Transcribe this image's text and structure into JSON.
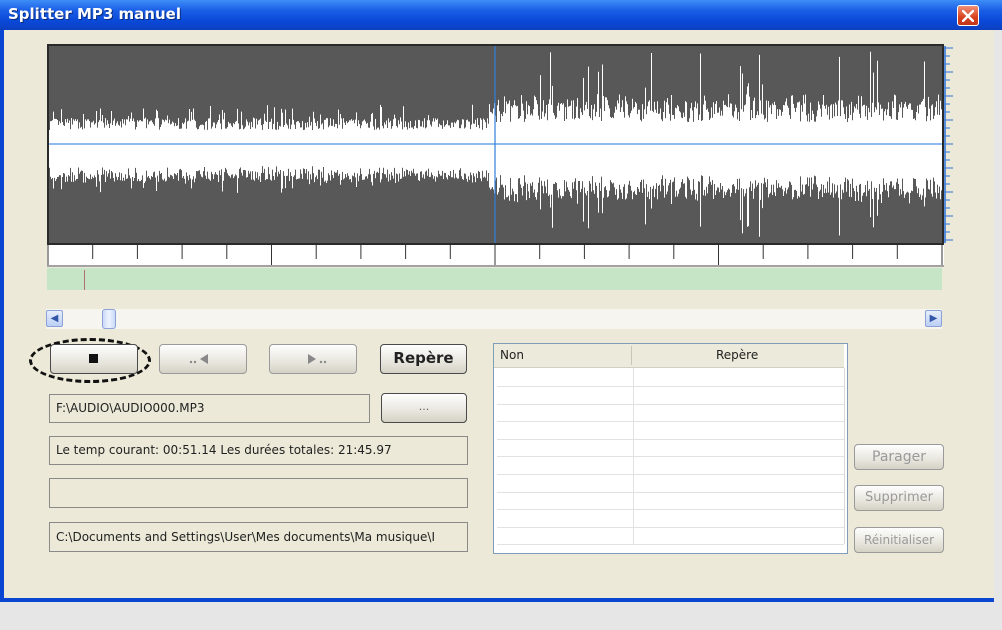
{
  "window": {
    "title": "Splitter MP3 manuel"
  },
  "controls": {
    "repere_label": "Repère",
    "browse_label": "...",
    "prev_label": "..◄",
    "next_label": "►.."
  },
  "fields": {
    "source_path": "F:\\AUDIO\\AUDIO000.MP3",
    "time_info": "Le temp courant: 00:51.14  Les durées totales: 21:45.97",
    "empty": "",
    "output_path": "C:\\Documents and Settings\\User\\Mes documents\\Ma musique\\I"
  },
  "list": {
    "columns": [
      "Non",
      "Repère"
    ],
    "rows": []
  },
  "side_buttons": {
    "partager": "Parager",
    "supprimer": "Supprimer",
    "reinitialiser": "Réinitialiser"
  },
  "colors": {
    "titlebar": "#0a49d8",
    "waveform_bg": "#585858",
    "waveform": "#ffffff",
    "cursor": "#2f7fd8",
    "timeline_bar": "#c6e5c6",
    "dialog_bg": "#ece9d8"
  },
  "icons": {
    "stop": "stop-icon",
    "close": "close-icon"
  }
}
